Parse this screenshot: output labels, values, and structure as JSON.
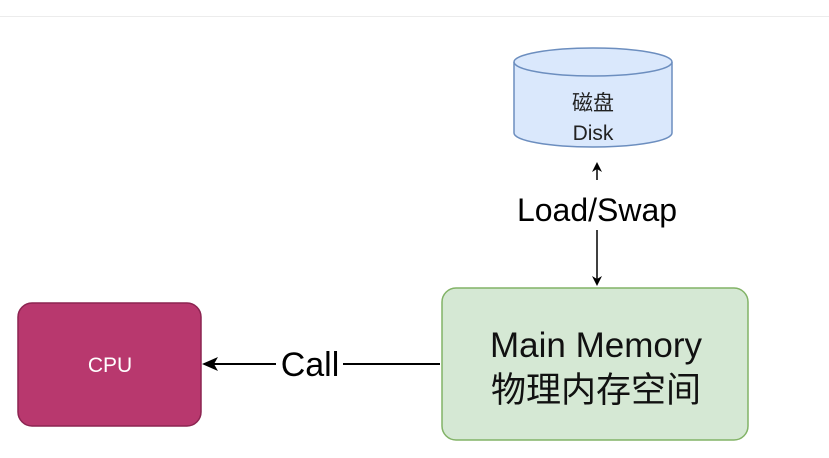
{
  "diagram": {
    "disk": {
      "line1": "磁盘",
      "line2": "Disk"
    },
    "load_swap_label": "Load/Swap",
    "main_memory": {
      "line1": "Main Memory",
      "line2": "物理内存空间"
    },
    "call_label": "Call",
    "cpu": {
      "label": "CPU"
    }
  },
  "colors": {
    "disk_fill": "#dae8fc",
    "disk_stroke": "#6c8ebf",
    "memory_fill": "#d5e8d4",
    "memory_stroke": "#82b366",
    "cpu_fill": "#b8386e",
    "cpu_stroke": "#8c2451",
    "line": "#000000"
  }
}
